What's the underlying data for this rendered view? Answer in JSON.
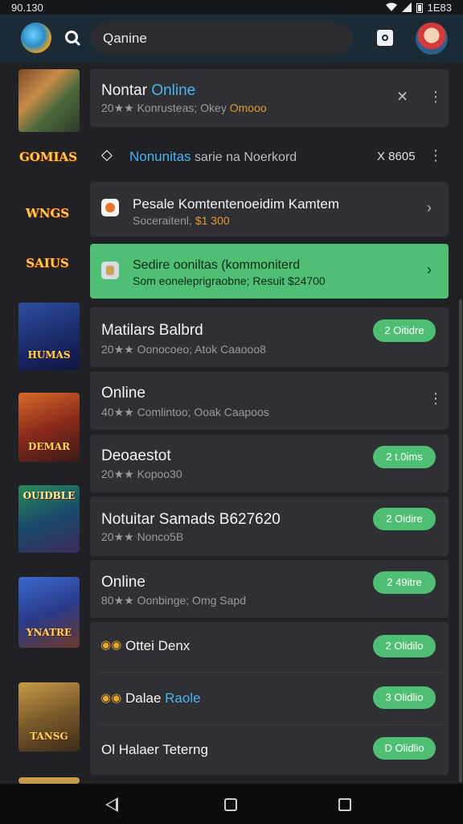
{
  "status_bar": {
    "time": "90.130",
    "battery_text": "1E83"
  },
  "header": {
    "search_text": "Qanine"
  },
  "items": [
    {
      "title_a": "Nontar ",
      "title_b": "Online",
      "sub_a": "20★★ Konrusteas; Okey ",
      "sub_b": "Omooo"
    },
    {
      "title": "Nonunitas",
      "title_tail": " sarie na Noerkord",
      "right_text": "X 8605"
    },
    {
      "title": "Pesale Komtentenoeidim Kamtem",
      "sub_a": "Soceraitenl, ",
      "sub_b": "$1 300"
    },
    {
      "title": "Sedire ooniltas (kommoniterd",
      "sub": "Som eoneleprigraobne; Resuit $24700"
    },
    {
      "title": "Matilars Balbrd",
      "sub": "20★★ Oonocoeo; Atok Caaooo8",
      "pill": "2 Oitidre"
    },
    {
      "title": "Online",
      "sub": "40★★ Comlintoo; Ooak Caapoos"
    },
    {
      "title": "Deoaestot",
      "sub": "20★★ Kopoo30",
      "pill": "2 t.0ims"
    },
    {
      "title": "Notuitar Samads B627620",
      "sub": "20★★ Nonco5B",
      "pill": "2 Oidire"
    },
    {
      "title": "Online",
      "sub": "80★★ Oonbinge; Omg Sapd",
      "pill": "2 49itre"
    },
    {
      "title": "Ottei Denx",
      "pill": "2 Olidilo"
    },
    {
      "title_a": "Dalae ",
      "title_b": "Raole",
      "pill": "3 Olidlio"
    },
    {
      "title": "Ol Halaer Teterng",
      "pill": "D Olidlio"
    }
  ],
  "thumbs": {
    "t2": "GOMIAS",
    "t3": "WNGS",
    "t4": "SAIUS",
    "t5": "HUMAS",
    "t6": "DEMAR",
    "t7": "OUIDBLE",
    "t8": "YNATRE",
    "t9": "TANSG"
  },
  "colors": {
    "accent": "#4ab3f0",
    "green": "#4fbf74",
    "orange": "#e39a2a"
  }
}
